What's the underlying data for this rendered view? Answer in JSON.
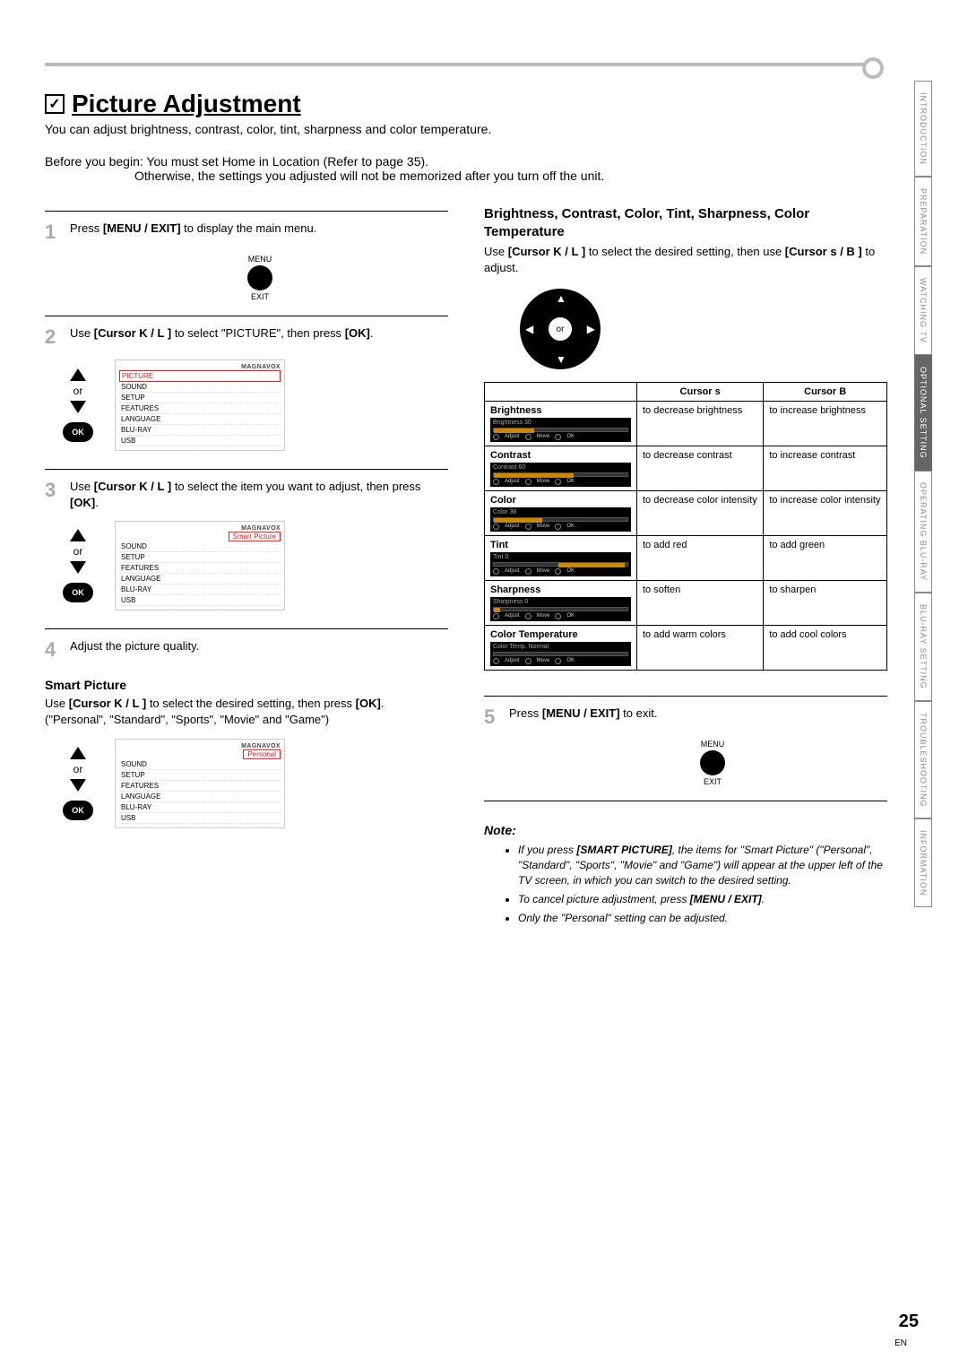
{
  "title": "Picture Adjustment",
  "intro": "You can adjust brightness, contrast, color, tint, sharpness and color temperature.",
  "before": {
    "label": "Before you begin:",
    "line1": "You must set  Home  in  Location  (Refer to page 35).",
    "line2": "Otherwise, the settings you adjusted will not be memorized after you turn off the unit."
  },
  "or": "or",
  "ok": "OK",
  "brand": "MAGNAVOX",
  "menuBtn": {
    "top": "MENU",
    "bot": "EXIT"
  },
  "steps": [
    {
      "n": "1",
      "pre": "Press",
      "b1": "[MENU / EXIT]",
      "post": "to display the main menu."
    },
    {
      "n": "2",
      "pre": "Use",
      "b1": "[Cursor K / L ]",
      "mid": "to select \"PICTURE\", then press",
      "b2": "[OK]",
      "post": "."
    },
    {
      "n": "3",
      "pre": "Use",
      "b1": "[Cursor K / L ]",
      "mid": "to select the item you want to adjust, then press",
      "b2": "[OK]",
      "post": "."
    },
    {
      "n": "4",
      "pre": "Adjust the picture quality."
    },
    {
      "n": "5",
      "pre": "Press",
      "b1": "[MENU / EXIT]",
      "post": "to exit."
    }
  ],
  "menu1": [
    "PICTURE",
    "SOUND",
    "SETUP",
    "FEATURES",
    "LANGUAGE",
    "BLU-RAY",
    "USB"
  ],
  "menu2": [
    "SOUND",
    "SETUP",
    "FEATURES",
    "LANGUAGE",
    "BLU-RAY",
    "USB"
  ],
  "menu2sel": "Smart Picture",
  "menu3sel": "Personal",
  "smart": {
    "head": "Smart Picture",
    "pre": "Use",
    "b1": "[Cursor K / L ]",
    "mid": "to select the desired setting, then press",
    "b2": "[OK]",
    "post": ".",
    "options": "(\"Personal\", \"Standard\", \"Sports\", \"Movie\" and \"Game\")"
  },
  "right": {
    "head": "Brightness, Contrast, Color, Tint, Sharpness, Color Temperature",
    "pre": "Use",
    "b1": "[Cursor K / L ]",
    "mid": "to select the desired setting, then use",
    "b2": "[Cursor s / B ]",
    "post": "to adjust."
  },
  "table": {
    "h1": "Cursor s",
    "h2": "Cursor B",
    "rows": [
      {
        "name": "Brightness",
        "osd": "Brightness   30",
        "left": "to decrease brightness",
        "right": "to increase brightness"
      },
      {
        "name": "Contrast",
        "osd": "Contrast    60",
        "left": "to decrease contrast",
        "right": "to increase contrast"
      },
      {
        "name": "Color",
        "osd": "Color      36",
        "left": "to decrease color intensity",
        "right": "to increase color intensity"
      },
      {
        "name": "Tint",
        "osd": "Tint        0",
        "left": "to add red",
        "right": "to add green"
      },
      {
        "name": "Sharpness",
        "osd": "Sharpness    0",
        "left": "to soften",
        "right": "to sharpen"
      },
      {
        "name": "Color Temperature",
        "osd": "Color Temp. Normal",
        "left": "to add warm colors",
        "right": "to add cool colors"
      }
    ]
  },
  "note": {
    "lbl": "Note:",
    "items": [
      {
        "a": "If you press",
        "b": "[SMART PICTURE]",
        "c": ", the items for \"Smart Picture\" (\"Personal\", \"Standard\", \"Sports\", \"Movie\" and \"Game\") will appear at the upper left of the TV screen, in which you can switch to the desired setting."
      },
      {
        "a": "To cancel picture adjustment, press",
        "b": "[MENU / EXIT]",
        "c": "."
      },
      {
        "a": "Only the \"Personal\" setting can be adjusted."
      }
    ]
  },
  "tabs": [
    "INTRODUCTION",
    "PREPARATION",
    "WATCHING TV",
    "OPTIONAL SETTING",
    "OPERATING BLU-RAY",
    "BLU-RAY SETTING",
    "TROUBLESHOOTING",
    "INFORMATION"
  ],
  "page": "25",
  "lang": "EN"
}
